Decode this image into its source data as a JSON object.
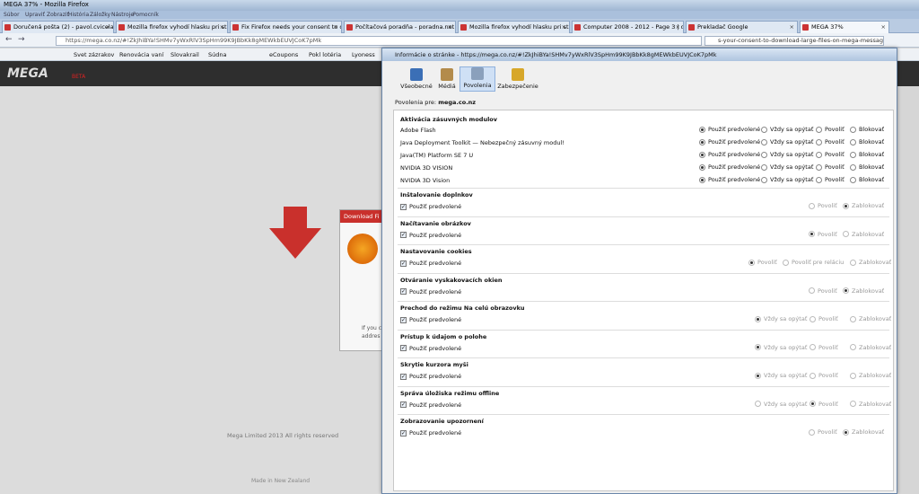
{
  "window": {
    "title": "MEGA 37% - Mozilla Firefox"
  },
  "menu": [
    "Súbor",
    "Upraviť",
    "Zobraziť",
    "História",
    "Záložky",
    "Nástroje",
    "Pomocník"
  ],
  "tabs": [
    {
      "label": "Doručená pošta (2) - pavol.cvicela..."
    },
    {
      "label": "Mozilla firefox vyhodí hlasku pri st..."
    },
    {
      "label": "Fix Firefox needs your consent to d..."
    },
    {
      "label": "Počítačová poradňa - poradna.net"
    },
    {
      "label": "Mozilla firefox vyhodí hlasku pri st..."
    },
    {
      "label": "Computer 2008 - 2012 - Page 3 | d..."
    },
    {
      "label": "Prekladač Google"
    },
    {
      "label": "MEGA 37%"
    }
  ],
  "nav": {
    "url": "https://mega.co.nz/#!ZkJhiBYa!SHMv7yWxRlV3SpHm99K9JBbKk8gMEWkbEUVJCoK7pMk",
    "search": "s-your-consent-to-download-large-files-on-mega-message/"
  },
  "bookmarks": [
    "Svet zázrakov",
    "Renovácia vaní",
    "Slovakrail",
    "Súdna",
    "eCoupons",
    "Pokl lotéria",
    "Lyoness"
  ],
  "mega": {
    "logo": "MEGA",
    "beta": "BETA",
    "footer": "Mega Limited 2013  All rights reserved",
    "made_in": "Made in New Zealand",
    "popup_title": "Download Fi",
    "popup_text_1": "If you c",
    "popup_text_2": "addres"
  },
  "dialog": {
    "title": "Informácie o stránke - https://mega.co.nz/#!ZkJhiBYa!SHMv7yWxRlV3SpHm99K9JBbKk8gMEWkbEUVJCoK7pMk",
    "toolbar": [
      "Všeobecné",
      "Médiá",
      "Povolenia",
      "Zabezpečenie"
    ],
    "permissions_for_label": "Povolenia pre:",
    "permissions_for_site": "mega.co.nz",
    "plugins_title": "Aktivácia zásuvných modulov",
    "plugins": [
      "Adobe Flash",
      "Java Deployment Toolkit — Nebezpečný zásuvný modul!",
      "Java(TM) Platform SE 7 U",
      "NVIDIA 3D VISION",
      "NVIDIA 3D Vision"
    ],
    "plugin_options": [
      "Použiť predvolené",
      "Vždy sa opýtať",
      "Povoliť",
      "Blokovať"
    ],
    "use_default": "Použiť predvolené",
    "sections": [
      {
        "title": "Inštalovanie doplnkov",
        "options": [
          "Povoliť",
          "Zablokovať"
        ],
        "selected": 1
      },
      {
        "title": "Načítavanie obrázkov",
        "options": [
          "Povoliť",
          "Zablokovať"
        ],
        "selected": 0
      },
      {
        "title": "Nastavovanie cookies",
        "options": [
          "Povoliť",
          "Povoliť pre reláciu",
          "Zablokovať"
        ],
        "selected": 0
      },
      {
        "title": "Otváranie vyskakovacích okien",
        "options": [
          "Povoliť",
          "Zablokovať"
        ],
        "selected": 1
      },
      {
        "title": "Prechod do režimu Na celú obrazovku",
        "options": [
          "Vždy sa opýtať",
          "Povoliť",
          "Zablokovať"
        ],
        "selected": 0
      },
      {
        "title": "Prístup k údajom o polohe",
        "options": [
          "Vždy sa opýtať",
          "Povoliť",
          "Zablokovať"
        ],
        "selected": 0
      },
      {
        "title": "Skrytie kurzora myši",
        "options": [
          "Vždy sa opýtať",
          "Povoliť",
          "Zablokovať"
        ],
        "selected": 0
      },
      {
        "title": "Správa úložiska režimu offline",
        "options": [
          "Vždy sa opýtať",
          "Povoliť",
          "Zablokovať"
        ],
        "selected": 1
      },
      {
        "title": "Zobrazovanie upozornení",
        "options": [
          "Povoliť",
          "Zablokovať"
        ],
        "selected": 1
      }
    ]
  }
}
